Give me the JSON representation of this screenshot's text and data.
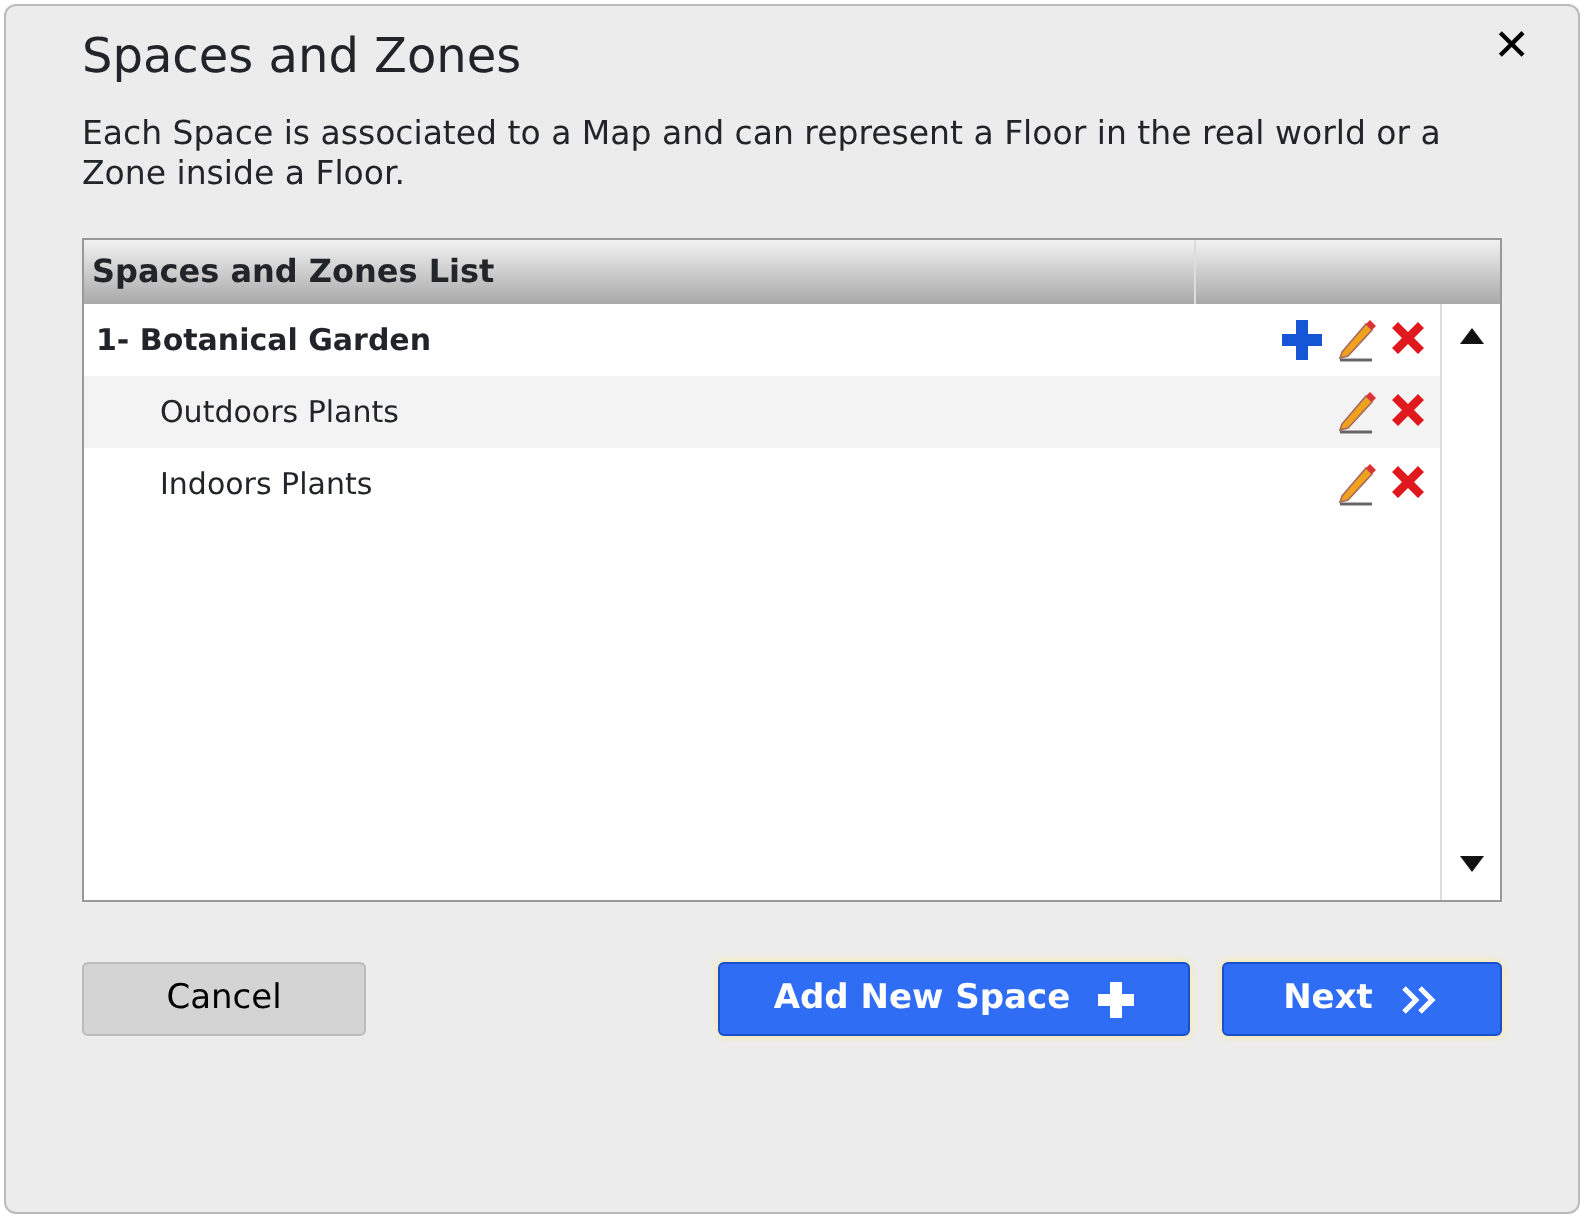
{
  "window": {
    "title": "Spaces and Zones",
    "close": "✕"
  },
  "description": "Each Space is associated to a Map and can represent a Floor in the real world or a Zone inside a Floor.",
  "list": {
    "columns": [
      "Spaces and Zones List"
    ],
    "items": [
      {
        "label": "1- Botanical Garden",
        "kind": "space",
        "children": [
          {
            "label": "Outdoors Plants",
            "kind": "zone"
          },
          {
            "label": "Indoors Plants",
            "kind": "zone"
          }
        ]
      }
    ]
  },
  "buttons": [
    {
      "label": "Cancel",
      "kind": "secondary"
    },
    {
      "label": "Add New Space",
      "kind": "add"
    },
    {
      "label": "Next",
      "kind": "next"
    }
  ]
}
